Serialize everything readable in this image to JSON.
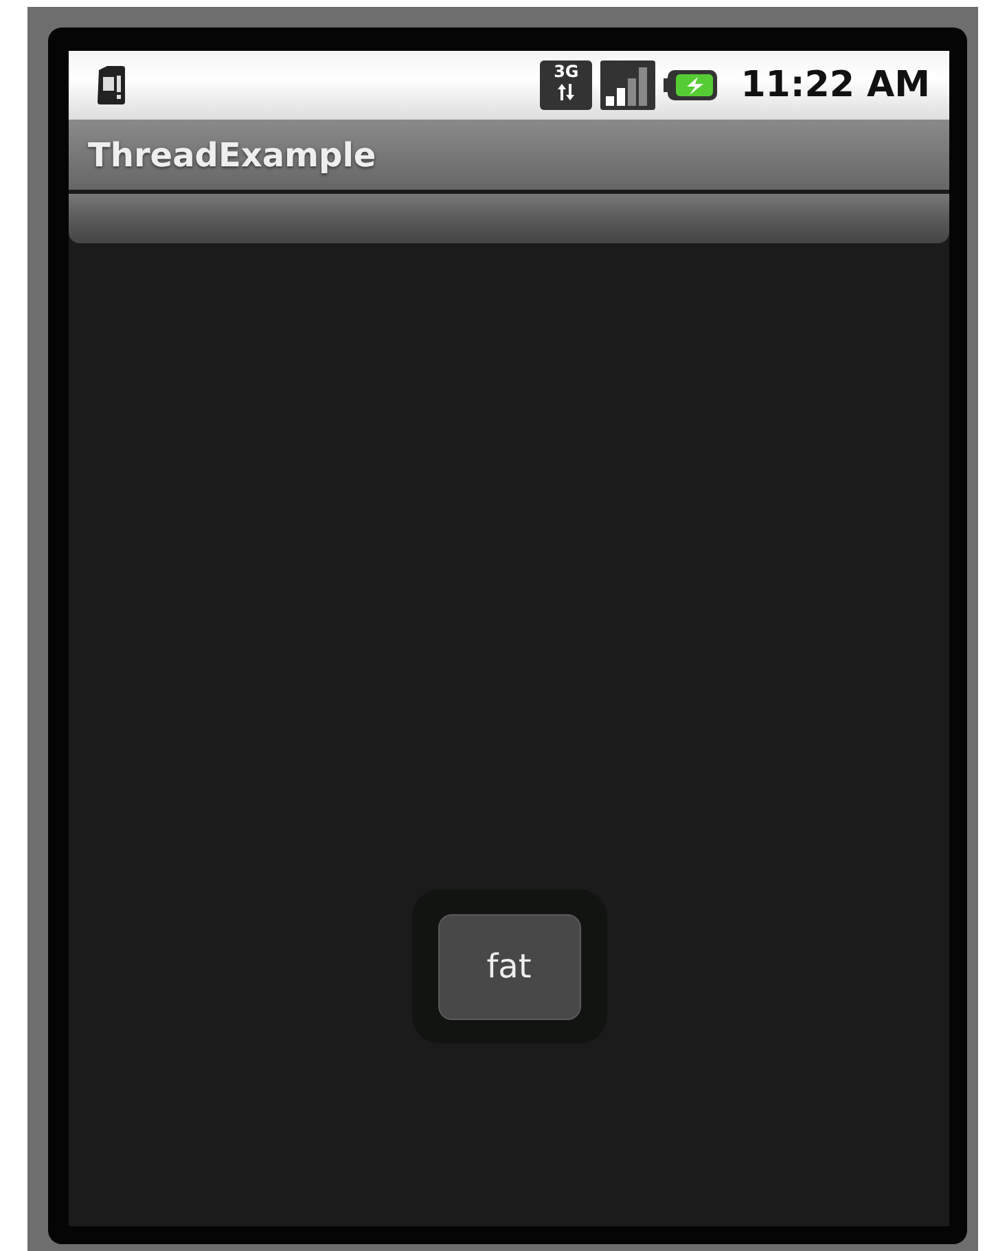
{
  "status_bar": {
    "network": "3G",
    "time": "11:22 AM"
  },
  "title_bar": {
    "title": "ThreadExample"
  },
  "toast": {
    "button": "fat"
  }
}
